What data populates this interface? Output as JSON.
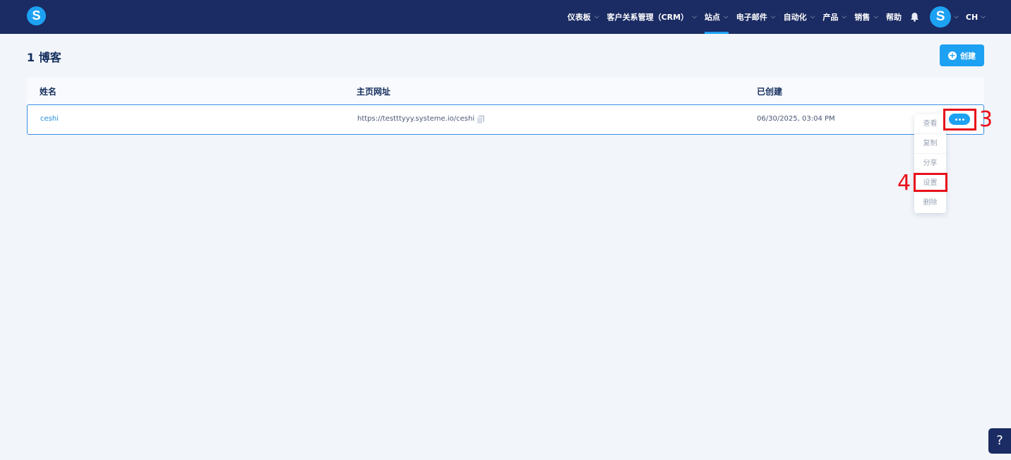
{
  "app": {
    "logo_letter": "S"
  },
  "nav": {
    "items": [
      {
        "label": "仪表板",
        "chevron": true
      },
      {
        "label": "客户关系管理（CRM）",
        "chevron": true
      },
      {
        "label": "站点",
        "chevron": true,
        "active": true
      },
      {
        "label": "电子邮件",
        "chevron": true
      },
      {
        "label": "自动化",
        "chevron": true
      },
      {
        "label": "产品",
        "chevron": true
      },
      {
        "label": "销售",
        "chevron": true
      },
      {
        "label": "帮助",
        "chevron": false
      }
    ],
    "avatar_letter": "S",
    "language": "CH"
  },
  "page": {
    "title": "1 博客",
    "create_label": "创建"
  },
  "table": {
    "headers": [
      "姓名",
      "主页网址",
      "已创建"
    ],
    "rows": [
      {
        "name": "ceshi",
        "url": "https://testttyyy.systeme.io/ceshi",
        "created": "06/30/2025, 03:04 PM"
      }
    ]
  },
  "dropdown": {
    "items": [
      "查看",
      "复制",
      "分享",
      "设置",
      "删除"
    ]
  },
  "annotations": {
    "step3": "3",
    "step4": "4"
  },
  "help": {
    "label": "?"
  },
  "colors": {
    "nav_bg": "#1b2b63",
    "accent": "#1da1f2",
    "annotation": "#e8101a"
  },
  "icons": {
    "bell": "bell-icon",
    "copy": "copy-icon",
    "more": "more-dots-icon",
    "plus": "plus-circle-icon"
  }
}
